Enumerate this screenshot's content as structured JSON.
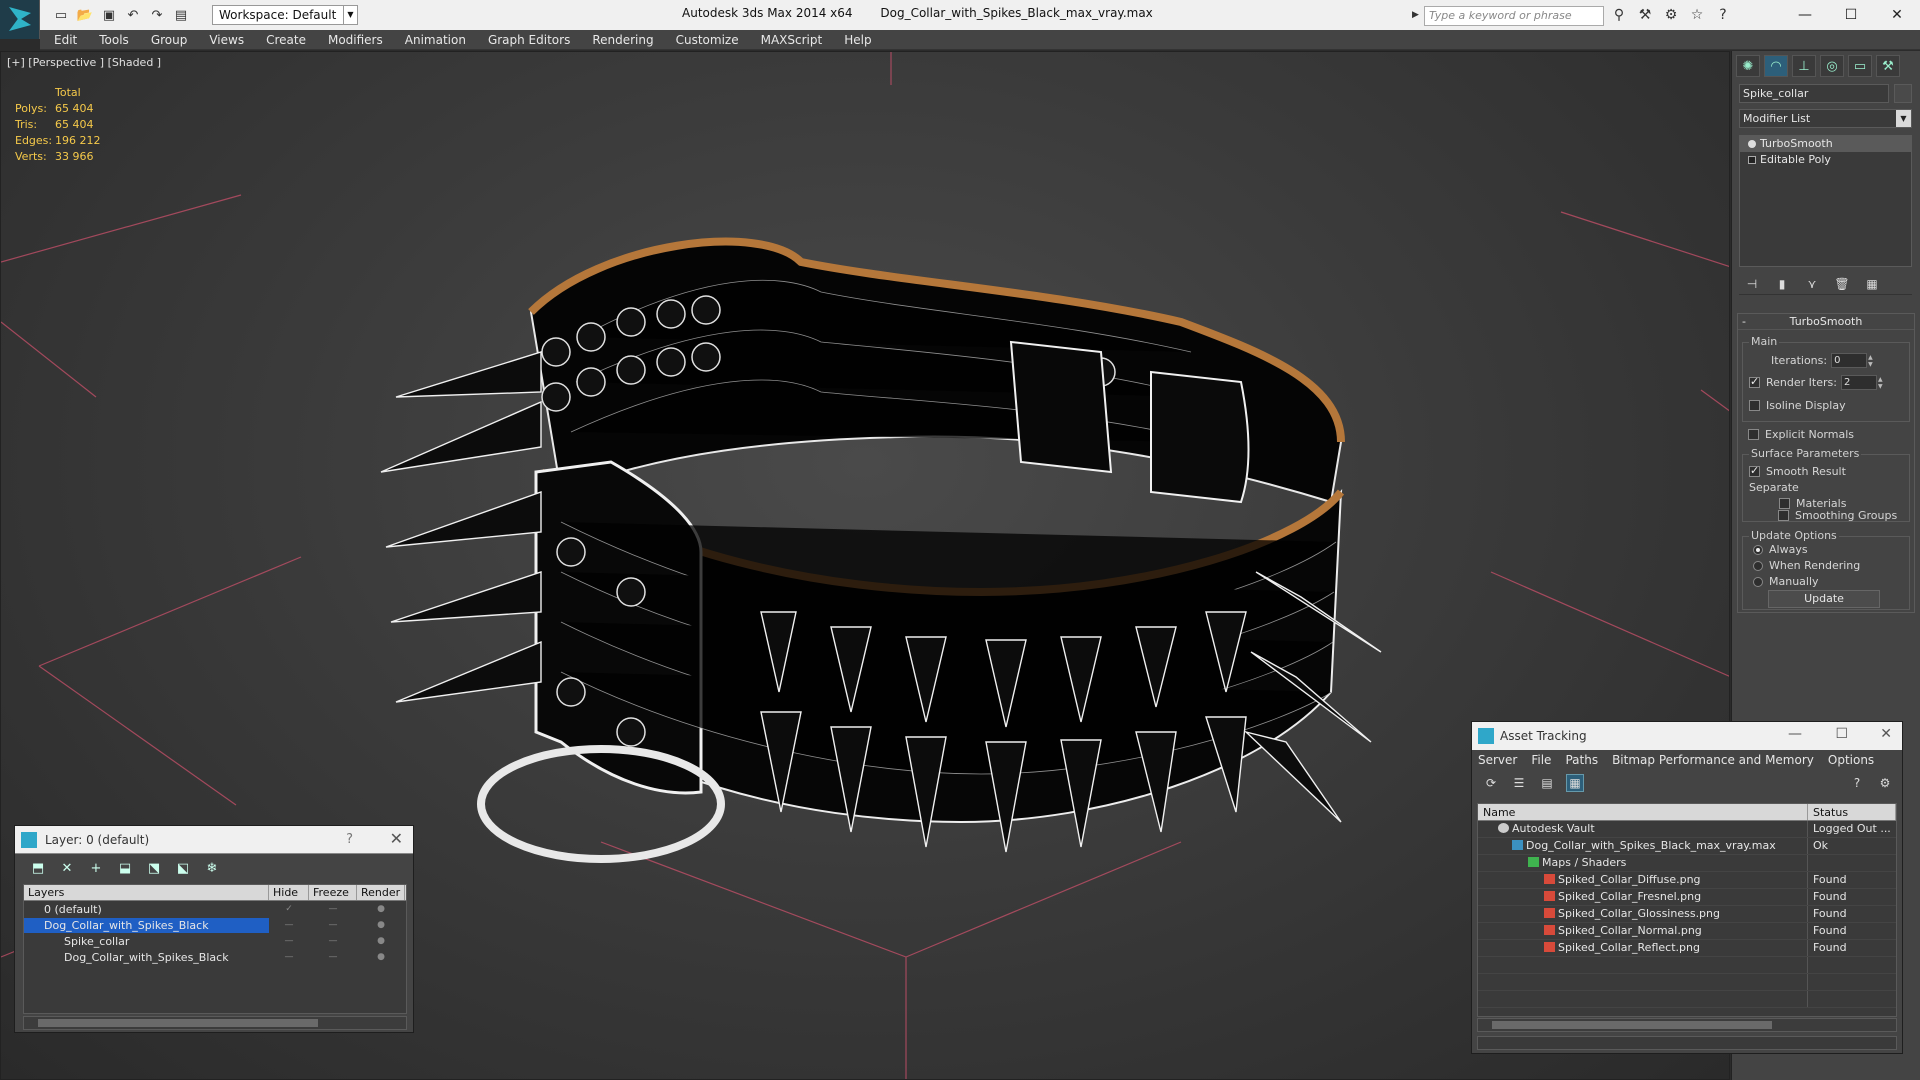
{
  "title": {
    "app": "Autodesk 3ds Max  2014 x64",
    "file": "Dog_Collar_with_Spikes_Black_max_vray.max",
    "workspace": "Workspace: Default",
    "search_placeholder": "Type a keyword or phrase"
  },
  "menu": [
    "Edit",
    "Tools",
    "Group",
    "Views",
    "Create",
    "Modifiers",
    "Animation",
    "Graph Editors",
    "Rendering",
    "Customize",
    "MAXScript",
    "Help"
  ],
  "viewport": {
    "label": "[+] [Perspective ] [Shaded ]",
    "stats_header": "Total",
    "stats": [
      {
        "k": "Polys:",
        "v": "65 404"
      },
      {
        "k": "Tris:",
        "v": "65 404"
      },
      {
        "k": "Edges:",
        "v": "196 212"
      },
      {
        "k": "Verts:",
        "v": "33 966"
      }
    ]
  },
  "command_panel": {
    "object_name": "Spike_collar",
    "modifier_list": "Modifier List",
    "stack": [
      {
        "name": "TurboSmooth",
        "selected": true
      },
      {
        "name": "Editable Poly",
        "selected": false
      }
    ],
    "turbosmooth": {
      "title": "TurboSmooth",
      "main": "Main",
      "iterations_label": "Iterations:",
      "iterations_value": "0",
      "render_iters_label": "Render Iters:",
      "render_iters_value": "2",
      "isoline": "Isoline Display",
      "explicit_normals": "Explicit Normals",
      "surface_params": "Surface Parameters",
      "smooth_result": "Smooth Result",
      "separate": "Separate",
      "materials": "Materials",
      "smoothing_groups": "Smoothing Groups",
      "update_options": "Update Options",
      "always": "Always",
      "when_rendering": "When Rendering",
      "manually": "Manually",
      "update": "Update"
    }
  },
  "layer_dialog": {
    "title": "Layer: 0 (default)",
    "columns": [
      "Layers",
      "Hide",
      "Freeze",
      "Render"
    ],
    "rows": [
      {
        "name": "0 (default)",
        "indent": 1,
        "selected": false
      },
      {
        "name": "Dog_Collar_with_Spikes_Black",
        "indent": 1,
        "selected": true
      },
      {
        "name": "Spike_collar",
        "indent": 2,
        "selected": false
      },
      {
        "name": "Dog_Collar_with_Spikes_Black",
        "indent": 2,
        "selected": false
      }
    ]
  },
  "asset_dialog": {
    "title": "Asset Tracking",
    "menu": [
      "Server",
      "File",
      "Paths",
      "Bitmap Performance and Memory",
      "Options"
    ],
    "columns": [
      "Name",
      "Status"
    ],
    "rows": [
      {
        "name": "Autodesk Vault",
        "status": "Logged Out ...",
        "indent": 1,
        "icon": "vault"
      },
      {
        "name": "Dog_Collar_with_Spikes_Black_max_vray.max",
        "status": "Ok",
        "indent": 2,
        "icon": "max"
      },
      {
        "name": "Maps / Shaders",
        "status": "",
        "indent": 3,
        "icon": "folder"
      },
      {
        "name": "Spiked_Collar_Diffuse.png",
        "status": "Found",
        "indent": 4,
        "icon": "png"
      },
      {
        "name": "Spiked_Collar_Fresnel.png",
        "status": "Found",
        "indent": 4,
        "icon": "png"
      },
      {
        "name": "Spiked_Collar_Glossiness.png",
        "status": "Found",
        "indent": 4,
        "icon": "png"
      },
      {
        "name": "Spiked_Collar_Normal.png",
        "status": "Found",
        "indent": 4,
        "icon": "png"
      },
      {
        "name": "Spiked_Collar_Reflect.png",
        "status": "Found",
        "indent": 4,
        "icon": "png"
      }
    ]
  }
}
